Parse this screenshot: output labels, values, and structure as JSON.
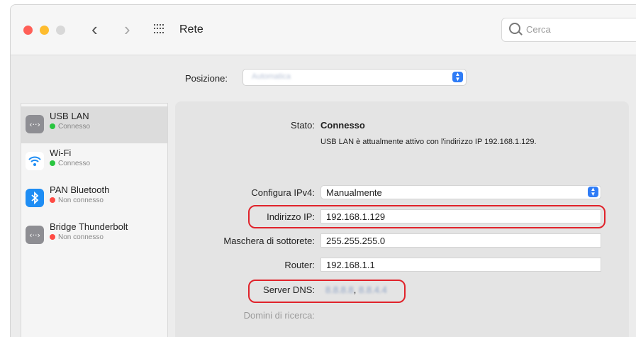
{
  "window": {
    "title": "Rete"
  },
  "toolbar": {
    "back_glyph": "‹",
    "forward_glyph": "›",
    "search_placeholder": "Cerca"
  },
  "location": {
    "label": "Posizione:",
    "value": "Automatica"
  },
  "sidebar": {
    "items": [
      {
        "name": "USB LAN",
        "status": "Connesso",
        "status_color": "#29c540",
        "icon": "ethernet-icon",
        "selected": true
      },
      {
        "name": "Wi-Fi",
        "status": "Connesso",
        "status_color": "#29c540",
        "icon": "wifi-icon",
        "selected": false
      },
      {
        "name": "PAN Bluetooth",
        "status": "Non connesso",
        "status_color": "#ff4b44",
        "icon": "bluetooth-icon",
        "selected": false
      },
      {
        "name": "Bridge Thunderbolt",
        "status": "Non connesso",
        "status_color": "#ff4b44",
        "icon": "ethernet-icon",
        "selected": false
      }
    ]
  },
  "detail": {
    "status_label": "Stato:",
    "status_value": "Connesso",
    "status_desc": "USB LAN è attualmente attivo con l'indirizzo IP 192.168.1.129.",
    "ipv4_label": "Configura IPv4:",
    "ipv4_value": "Manualmente",
    "ip_label": "Indirizzo IP:",
    "ip_value": "192.168.1.129",
    "mask_label": "Maschera di sottorete:",
    "mask_value": "255.255.255.0",
    "router_label": "Router:",
    "router_value": "192.168.1.1",
    "dns_label": "Server DNS:",
    "dns_value_1": "8.8.8.8",
    "dns_sep": ",",
    "dns_value_2": "8.8.4.4",
    "domains_label": "Domini di ricerca:"
  },
  "colors": {
    "highlight": "#e0232b",
    "accent": "#2f7cf6"
  }
}
